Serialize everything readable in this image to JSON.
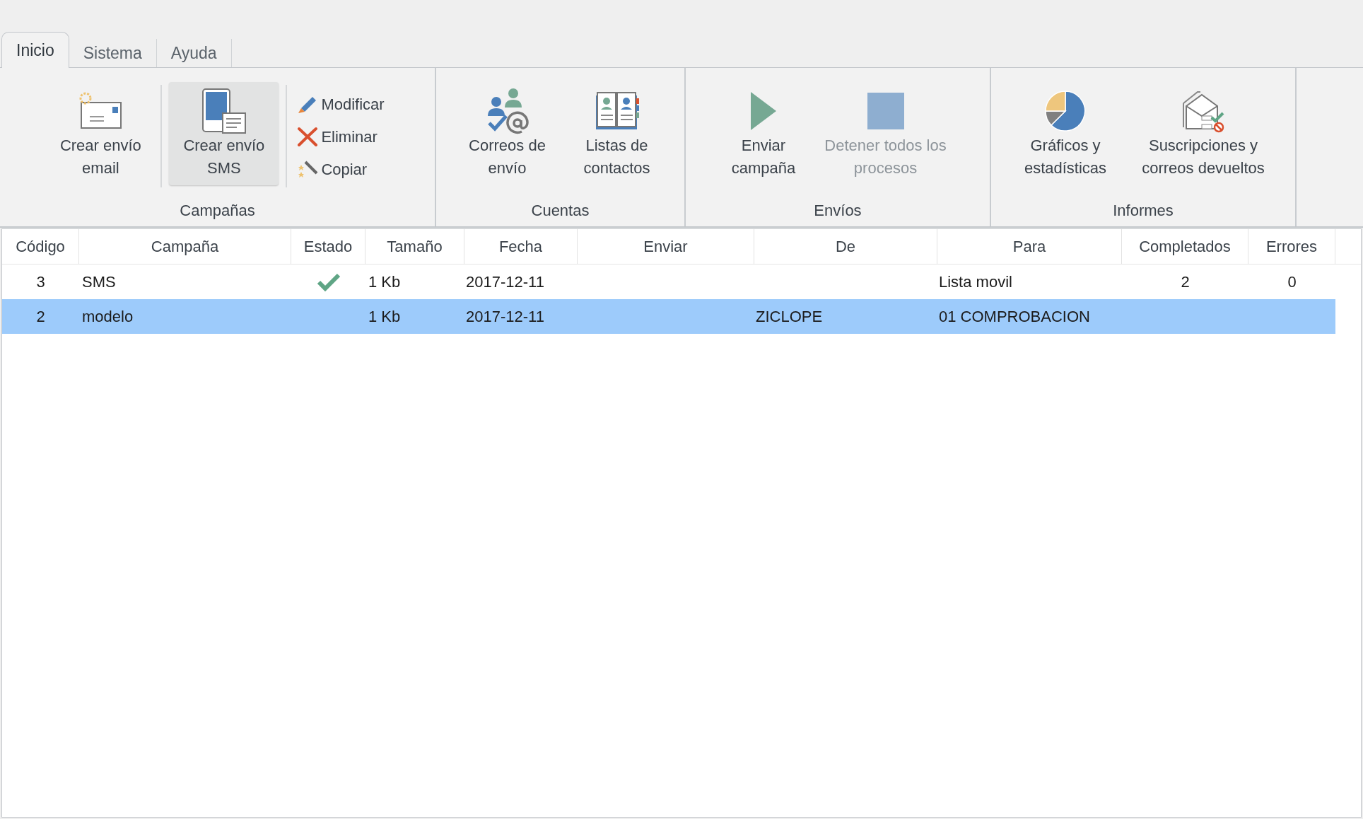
{
  "tabs": [
    {
      "label": "Inicio",
      "selected": true
    },
    {
      "label": "Sistema",
      "selected": false
    },
    {
      "label": "Ayuda",
      "selected": false
    }
  ],
  "ribbon_groups": [
    {
      "label": "Campañas",
      "items": [
        {
          "kind": "large",
          "label": "Crear envío email",
          "disabled": false,
          "highlighted": false
        },
        {
          "kind": "large",
          "label": "Crear envío SMS",
          "disabled": false,
          "highlighted": true
        },
        {
          "kind": "stack",
          "items": [
            {
              "label": "Modificar"
            },
            {
              "label": "Eliminar"
            },
            {
              "label": "Copiar"
            }
          ]
        }
      ]
    },
    {
      "label": "Cuentas",
      "items": [
        {
          "kind": "large",
          "label": "Correos de envío",
          "disabled": false,
          "highlighted": false
        },
        {
          "kind": "large",
          "label": "Listas de contactos",
          "disabled": false,
          "highlighted": false
        }
      ]
    },
    {
      "label": "Envíos",
      "items": [
        {
          "kind": "large",
          "label": "Enviar campaña",
          "disabled": false,
          "highlighted": false
        },
        {
          "kind": "large",
          "label": "Detener todos los procesos",
          "disabled": true,
          "highlighted": false
        }
      ]
    },
    {
      "label": "Informes",
      "items": [
        {
          "kind": "large",
          "label": "Gráficos y estadísticas",
          "disabled": false,
          "highlighted": false
        },
        {
          "kind": "large",
          "label": "Suscripciones y correos devueltos",
          "disabled": false,
          "highlighted": false
        }
      ]
    }
  ],
  "table": {
    "columns": [
      "Código",
      "Campaña",
      "Estado",
      "Tamaño",
      "Fecha",
      "Enviar",
      "De",
      "Para",
      "Completados",
      "Errores"
    ],
    "rows": [
      {
        "codigo": "3",
        "campana": "SMS",
        "sent": true,
        "tamano": "1 Kb",
        "fecha": "2017-12-11",
        "para": "Lista movil",
        "completados": "2",
        "errores": "0",
        "selected": false
      },
      {
        "codigo": "2",
        "campana": "modelo",
        "sent": false,
        "tamano": "1 Kb",
        "fecha": "2017-12-11",
        "de": "ZICLOPE",
        "para": "01 COMPROBACION",
        "selected": true
      }
    ]
  }
}
